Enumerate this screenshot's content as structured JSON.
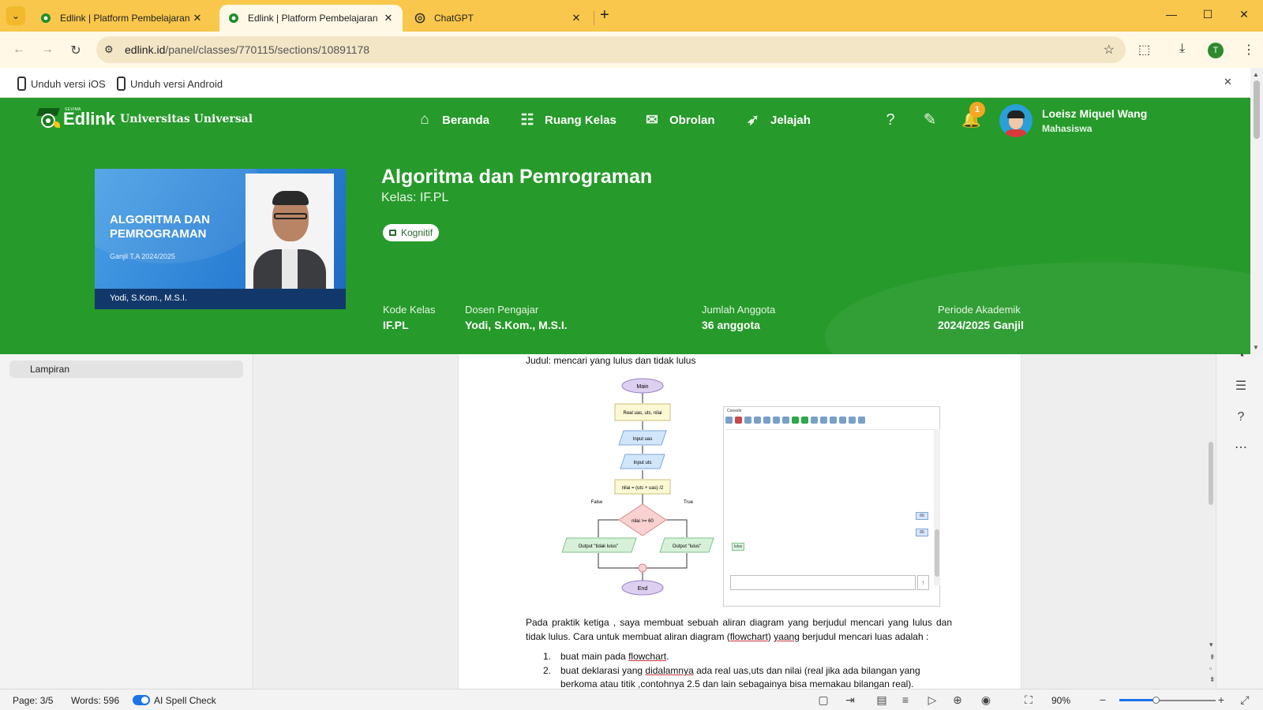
{
  "browser": {
    "tabs": [
      {
        "title": "Edlink | Platform Pembelajaran",
        "active": false
      },
      {
        "title": "Edlink | Platform Pembelajaran",
        "active": true
      },
      {
        "title": "ChatGPT",
        "active": false
      }
    ],
    "url_host": "edlink.id",
    "url_path": "/panel/classes/770115/sections/10891178",
    "profile_initial": "T"
  },
  "banner": {
    "ios_label": "Unduh versi iOS",
    "android_label": "Unduh versi Android"
  },
  "nav": {
    "logo_text": "Edlink",
    "logo_small": "SEVIMA",
    "university": "Universitas Universal",
    "links": [
      "Beranda",
      "Ruang Kelas",
      "Obrolan",
      "Jelajah"
    ],
    "notification_count": "1",
    "user_name": "Loeisz Miquel Wang",
    "user_role": "Mahasiswa"
  },
  "course": {
    "cover_title": "ALGORITMA DAN PEMROGRAMAN",
    "cover_sub": "Ganjil T.A 2024/2025",
    "cover_teacher": "Yodi, S.Kom., M.S.I.",
    "title": "Algoritma dan Pemrograman",
    "class_line": "Kelas: IF.PL",
    "chip": "Kognitif",
    "meta": [
      {
        "label": "Kode Kelas",
        "value": "IF.PL"
      },
      {
        "label": "Dosen Pengajar",
        "value": "Yodi, S.Kom., M.S.I."
      },
      {
        "label": "Jumlah Anggota",
        "value": "36 anggota"
      },
      {
        "label": "Periode Akademik",
        "value": "2024/2025 Ganjil"
      }
    ]
  },
  "sidebar": {
    "attachment_label": "Lampiran"
  },
  "document": {
    "heading": "Judul: mencari yang lulus dan tidak lulus",
    "flowchart": {
      "start": "Main",
      "declare": "Real uas, uts, nilai",
      "input1": "Input uas",
      "input2": "Input uts",
      "assign": "nilai = (uts + uas) /2",
      "decision": "nilai >= 60",
      "false_label": "False",
      "true_label": "True",
      "out_false": "Output \"tidak lulus\"",
      "out_true": "Output \"lulus\"",
      "end": "End"
    },
    "console": {
      "title": "Console",
      "out1": "60",
      "out2": "66",
      "out3": "lulus"
    },
    "paragraph_a": "Pada praktik ketiga , saya membuat sebuah aliran diagram yang berjudul mencari yang lulus dan tidak lulus. Cara untuk membuat aliran diagram (",
    "paragraph_u1": "flowchart",
    "paragraph_b": ") ",
    "paragraph_u2": "yaang",
    "paragraph_c": " berjudul mencari luas adalah :",
    "list": [
      {
        "num": "1.",
        "a": "buat main pada ",
        "u": "flowchart",
        "b": "."
      },
      {
        "num": "2.",
        "a": "buat deklarasi yang ",
        "u": "didalamnya",
        "b": " ada real uas,uts dan nilai (real jika ada bilangan yang berkoma atau titik ,contohnya 2.5 dan lain sebagainya bisa memakau bilangan real)."
      }
    ]
  },
  "statusbar": {
    "page": "Page: 3/5",
    "words": "Words: 596",
    "spell": "AI Spell Check",
    "zoom": "90%"
  },
  "colors": {
    "brand_green": "#269a2a",
    "tab_strip": "#f8c74c",
    "accent_blue": "#1a73e8"
  }
}
